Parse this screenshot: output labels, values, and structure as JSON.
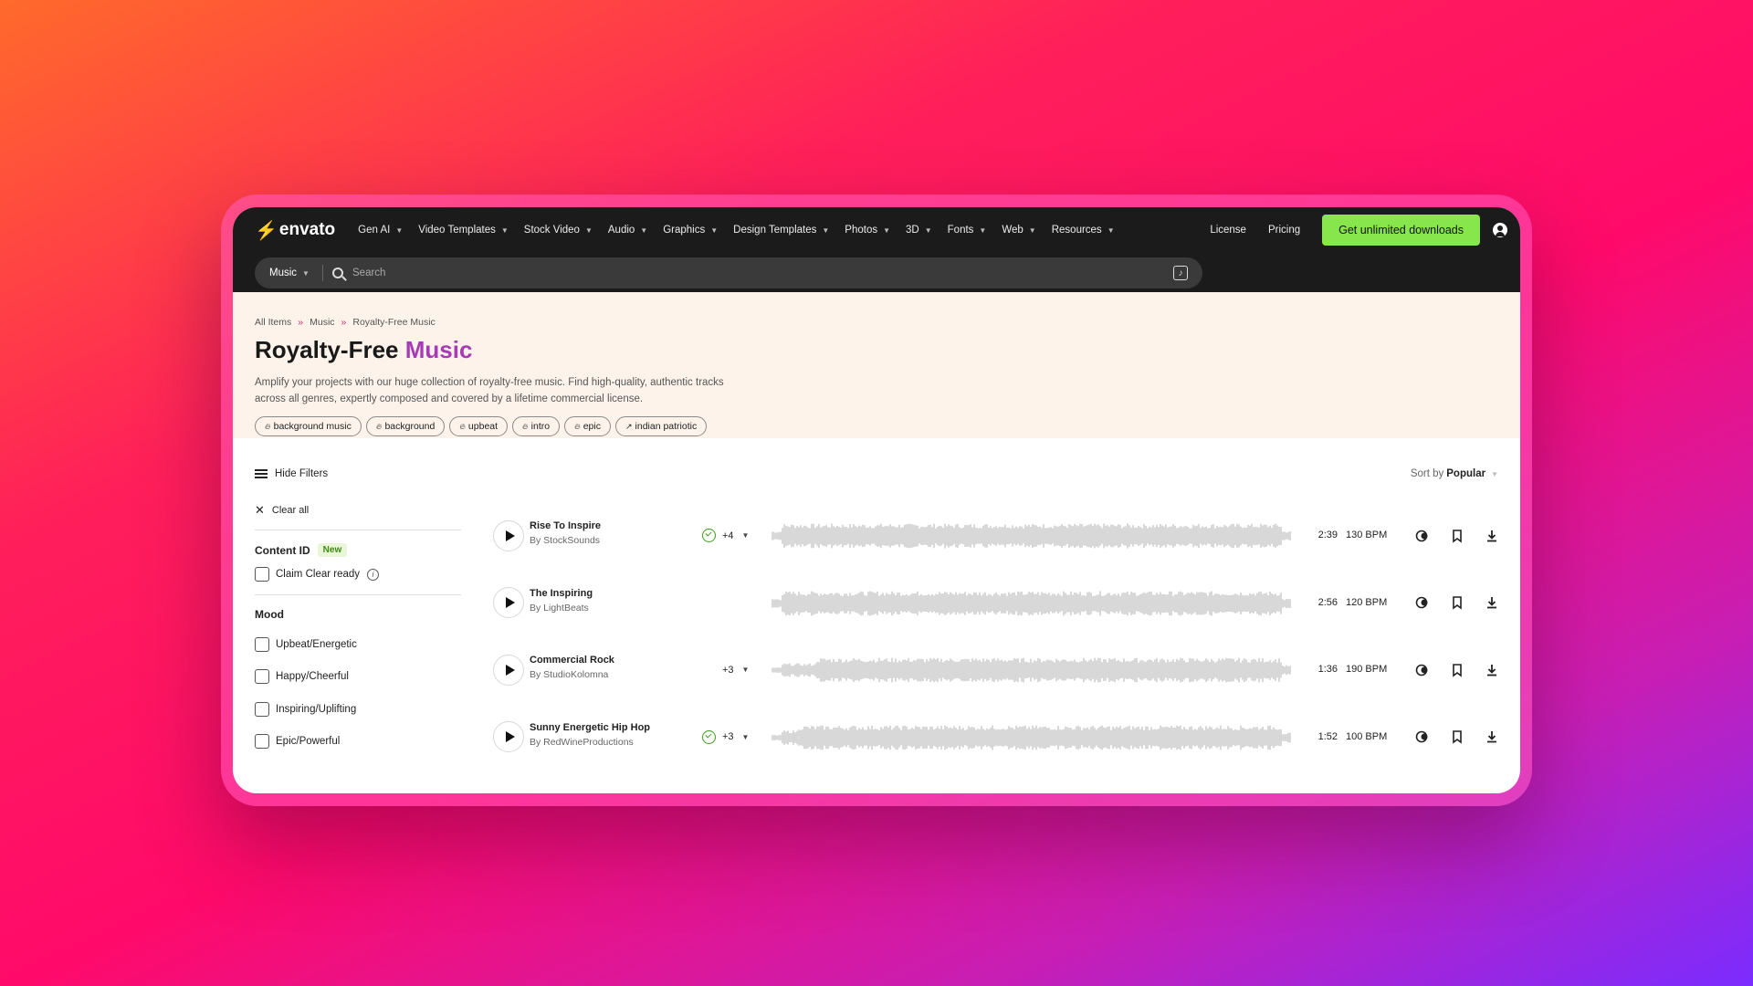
{
  "nav": {
    "logo": "envato",
    "menu": [
      "Gen AI",
      "Video Templates",
      "Stock Video",
      "Audio",
      "Graphics",
      "Design Templates",
      "Photos",
      "3D",
      "Fonts",
      "Web",
      "Resources"
    ],
    "license": "License",
    "pricing": "Pricing",
    "cta": "Get unlimited downloads"
  },
  "search": {
    "category": "Music",
    "placeholder": "Search"
  },
  "breadcrumb": [
    "All Items",
    "Music",
    "Royalty-Free Music"
  ],
  "hero": {
    "title_main": "Royalty-Free",
    "title_accent": "Music",
    "description": "Amplify your projects with our huge collection of royalty-free music. Find high-quality, authentic tracks across all genres, expertly composed and covered by a lifetime commercial license.",
    "tags": [
      {
        "label": "background music",
        "icon": "fire-icon"
      },
      {
        "label": "background",
        "icon": "fire-icon"
      },
      {
        "label": "upbeat",
        "icon": "fire-icon"
      },
      {
        "label": "intro",
        "icon": "fire-icon"
      },
      {
        "label": "epic",
        "icon": "fire-icon"
      },
      {
        "label": "indian patriotic",
        "icon": "trending-icon"
      }
    ]
  },
  "toolbar": {
    "hide_filters": "Hide Filters",
    "sort_label": "Sort by",
    "sort_value": "Popular"
  },
  "filters": {
    "clear_all": "Clear all",
    "content_id": {
      "title": "Content ID",
      "badge": "New",
      "option": "Claim Clear ready"
    },
    "mood": {
      "title": "Mood",
      "options": [
        "Upbeat/Energetic",
        "Happy/Cheerful",
        "Inspiring/Uplifting",
        "Epic/Powerful"
      ]
    }
  },
  "tracks": [
    {
      "title": "Rise To Inspire",
      "author": "By StockSounds",
      "claim_clear": true,
      "variants": "+4",
      "duration": "2:39",
      "bpm": "130 BPM"
    },
    {
      "title": "The Inspiring",
      "author": "By LightBeats",
      "claim_clear": false,
      "variants": "",
      "duration": "2:56",
      "bpm": "120 BPM"
    },
    {
      "title": "Commercial Rock",
      "author": "By StudioKolomna",
      "claim_clear": false,
      "variants": "+3",
      "duration": "1:36",
      "bpm": "190 BPM"
    },
    {
      "title": "Sunny Energetic Hip Hop",
      "author": "By RedWineProductions",
      "claim_clear": true,
      "variants": "+3",
      "duration": "1:52",
      "bpm": "100 BPM"
    }
  ],
  "colors": {
    "accent": "#a73ab5",
    "cta": "#87e64b",
    "nav_bg": "#1b1b1b",
    "hero_bg": "#fdf3ea",
    "claim_green": "#3a9b1c",
    "waveform": "#cfcfcf"
  }
}
